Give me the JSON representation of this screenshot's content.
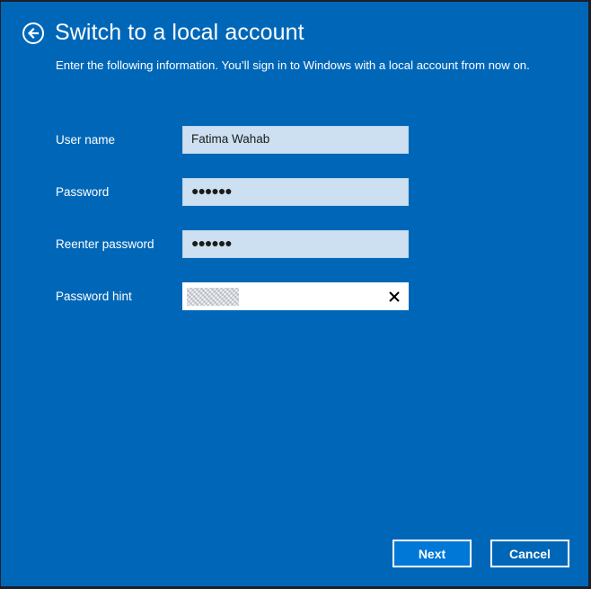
{
  "colors": {
    "background": "#0067b8",
    "field_fill": "#cce0f1",
    "primary_button": "#0078d7",
    "text": "#ffffff"
  },
  "header": {
    "back_icon": "back-arrow-circle-icon",
    "title": "Switch to a local account"
  },
  "description": "Enter the following information. You’ll sign in to Windows with a local account from now on.",
  "form": {
    "fields": [
      {
        "label": "User name",
        "value": "Fatima Wahab",
        "type": "text"
      },
      {
        "label": "Password",
        "value": "●●●●●●",
        "type": "password"
      },
      {
        "label": "Reenter password",
        "value": "●●●●●●",
        "type": "password"
      },
      {
        "label": "Password hint",
        "value": "",
        "type": "text",
        "redacted": true,
        "clear_icon": "close-icon"
      }
    ]
  },
  "buttons": {
    "next": "Next",
    "cancel": "Cancel"
  }
}
